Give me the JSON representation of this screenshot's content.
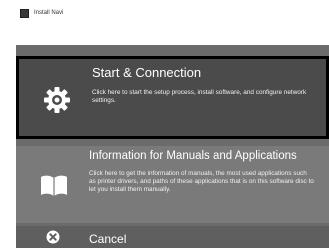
{
  "window": {
    "title": "Install Navi",
    "icon": "app-icon"
  },
  "menu": {
    "items": [
      {
        "id": "start",
        "icon": "gear-icon",
        "title": "Start & Connection",
        "description": "Click here to start the setup process, install software, and configure network settings.",
        "selected": true
      },
      {
        "id": "info",
        "icon": "book-icon",
        "title": "Information for Manuals and Applications",
        "description": "Click here to get the information of manuals, the most used applications such as printer drivers, and paths of these applications that is on this software disc to let you install them manually."
      },
      {
        "id": "cancel",
        "icon": "close-circle-icon",
        "title": "Cancel"
      }
    ]
  },
  "colors": {
    "selected_border": "#000000",
    "start_bg": "#4b4b4b",
    "info_bg": "#7a7a7a",
    "cancel_bg": "#5f5f5f",
    "text": "#ffffff"
  }
}
